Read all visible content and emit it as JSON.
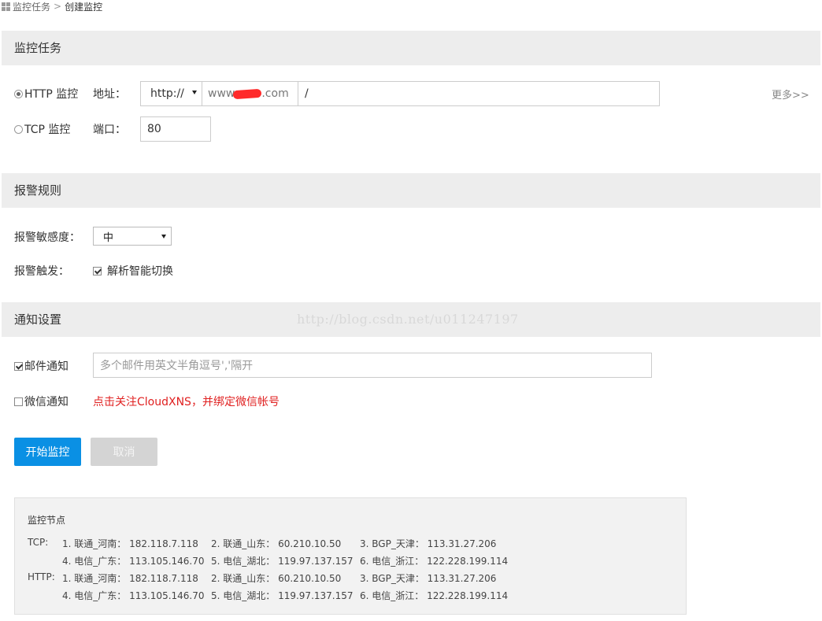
{
  "breadcrumb": {
    "parent": "监控任务",
    "current": "创建监控"
  },
  "sections": {
    "monitor_task": "监控任务",
    "alert_rules": "报警规则",
    "notify_settings": "通知设置"
  },
  "monitor": {
    "http_label": "HTTP 监控",
    "http_selected": true,
    "address_label": "地址：",
    "protocol_value": "http://",
    "domain_prefix": "www",
    "domain_suffix": ".com",
    "path_value": "/",
    "more_link": "更多>>",
    "tcp_label": "TCP 监控",
    "tcp_selected": false,
    "port_label": "端口：",
    "port_value": "80"
  },
  "alert": {
    "sensitivity_label": "报警敏感度：",
    "sensitivity_value": "中",
    "trigger_label": "报警触发：",
    "trigger_option": "解析智能切换",
    "trigger_checked": true
  },
  "notify": {
    "email_label": "邮件通知",
    "email_checked": true,
    "email_placeholder": "多个邮件用英文半角逗号','隔开",
    "wechat_label": "微信通知",
    "wechat_checked": false,
    "wechat_hint": "点击关注CloudXNS，并绑定微信帐号",
    "wechat_hint_color": "#e02020"
  },
  "buttons": {
    "start": "开始监控",
    "cancel": "取消",
    "start_color": "#0a90e4"
  },
  "watermark": "http://blog.csdn.net/u011247197",
  "nodes": {
    "title": "监控节点",
    "tcp_label": "TCP:",
    "http_label": "HTTP:",
    "tcp": [
      "1. 联通_河南： 182.118.7.118",
      "2. 联通_山东： 60.210.10.50",
      "3. BGP_天津： 113.31.27.206",
      "4. 电信_广东： 113.105.146.70",
      "5. 电信_湖北： 119.97.137.157",
      "6. 电信_浙江： 122.228.199.114"
    ],
    "http": [
      "1. 联通_河南： 182.118.7.118",
      "2. 联通_山东： 60.210.10.50",
      "3. BGP_天津： 113.31.27.206",
      "4. 电信_广东： 113.105.146.70",
      "5. 电信_湖北： 119.97.137.157",
      "6. 电信_浙江： 122.228.199.114"
    ]
  }
}
